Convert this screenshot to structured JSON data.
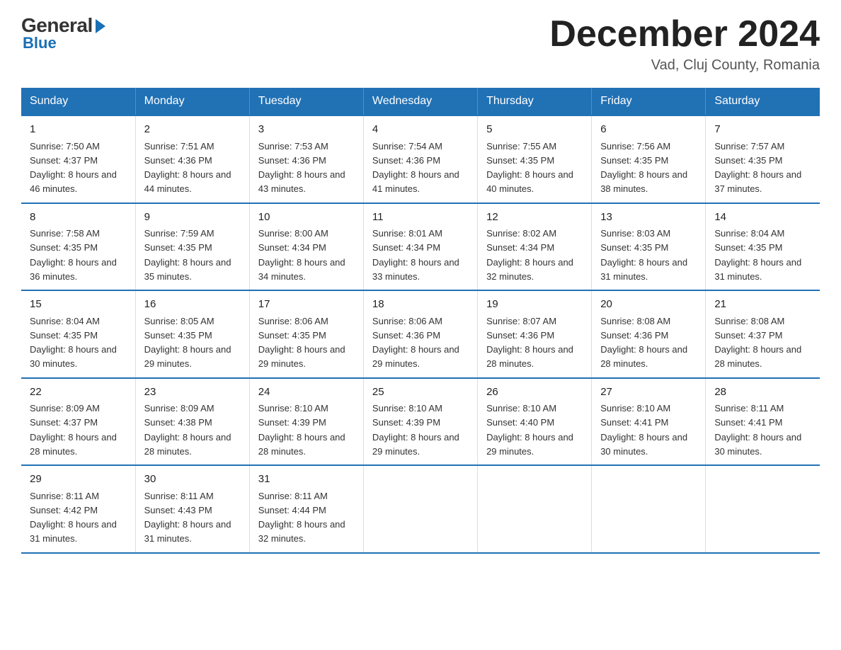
{
  "logo": {
    "general": "General",
    "blue": "Blue"
  },
  "title": "December 2024",
  "subtitle": "Vad, Cluj County, Romania",
  "days_header": [
    "Sunday",
    "Monday",
    "Tuesday",
    "Wednesday",
    "Thursday",
    "Friday",
    "Saturday"
  ],
  "weeks": [
    [
      {
        "day": "1",
        "sunrise": "7:50 AM",
        "sunset": "4:37 PM",
        "daylight": "8 hours and 46 minutes."
      },
      {
        "day": "2",
        "sunrise": "7:51 AM",
        "sunset": "4:36 PM",
        "daylight": "8 hours and 44 minutes."
      },
      {
        "day": "3",
        "sunrise": "7:53 AM",
        "sunset": "4:36 PM",
        "daylight": "8 hours and 43 minutes."
      },
      {
        "day": "4",
        "sunrise": "7:54 AM",
        "sunset": "4:36 PM",
        "daylight": "8 hours and 41 minutes."
      },
      {
        "day": "5",
        "sunrise": "7:55 AM",
        "sunset": "4:35 PM",
        "daylight": "8 hours and 40 minutes."
      },
      {
        "day": "6",
        "sunrise": "7:56 AM",
        "sunset": "4:35 PM",
        "daylight": "8 hours and 38 minutes."
      },
      {
        "day": "7",
        "sunrise": "7:57 AM",
        "sunset": "4:35 PM",
        "daylight": "8 hours and 37 minutes."
      }
    ],
    [
      {
        "day": "8",
        "sunrise": "7:58 AM",
        "sunset": "4:35 PM",
        "daylight": "8 hours and 36 minutes."
      },
      {
        "day": "9",
        "sunrise": "7:59 AM",
        "sunset": "4:35 PM",
        "daylight": "8 hours and 35 minutes."
      },
      {
        "day": "10",
        "sunrise": "8:00 AM",
        "sunset": "4:34 PM",
        "daylight": "8 hours and 34 minutes."
      },
      {
        "day": "11",
        "sunrise": "8:01 AM",
        "sunset": "4:34 PM",
        "daylight": "8 hours and 33 minutes."
      },
      {
        "day": "12",
        "sunrise": "8:02 AM",
        "sunset": "4:34 PM",
        "daylight": "8 hours and 32 minutes."
      },
      {
        "day": "13",
        "sunrise": "8:03 AM",
        "sunset": "4:35 PM",
        "daylight": "8 hours and 31 minutes."
      },
      {
        "day": "14",
        "sunrise": "8:04 AM",
        "sunset": "4:35 PM",
        "daylight": "8 hours and 31 minutes."
      }
    ],
    [
      {
        "day": "15",
        "sunrise": "8:04 AM",
        "sunset": "4:35 PM",
        "daylight": "8 hours and 30 minutes."
      },
      {
        "day": "16",
        "sunrise": "8:05 AM",
        "sunset": "4:35 PM",
        "daylight": "8 hours and 29 minutes."
      },
      {
        "day": "17",
        "sunrise": "8:06 AM",
        "sunset": "4:35 PM",
        "daylight": "8 hours and 29 minutes."
      },
      {
        "day": "18",
        "sunrise": "8:06 AM",
        "sunset": "4:36 PM",
        "daylight": "8 hours and 29 minutes."
      },
      {
        "day": "19",
        "sunrise": "8:07 AM",
        "sunset": "4:36 PM",
        "daylight": "8 hours and 28 minutes."
      },
      {
        "day": "20",
        "sunrise": "8:08 AM",
        "sunset": "4:36 PM",
        "daylight": "8 hours and 28 minutes."
      },
      {
        "day": "21",
        "sunrise": "8:08 AM",
        "sunset": "4:37 PM",
        "daylight": "8 hours and 28 minutes."
      }
    ],
    [
      {
        "day": "22",
        "sunrise": "8:09 AM",
        "sunset": "4:37 PM",
        "daylight": "8 hours and 28 minutes."
      },
      {
        "day": "23",
        "sunrise": "8:09 AM",
        "sunset": "4:38 PM",
        "daylight": "8 hours and 28 minutes."
      },
      {
        "day": "24",
        "sunrise": "8:10 AM",
        "sunset": "4:39 PM",
        "daylight": "8 hours and 28 minutes."
      },
      {
        "day": "25",
        "sunrise": "8:10 AM",
        "sunset": "4:39 PM",
        "daylight": "8 hours and 29 minutes."
      },
      {
        "day": "26",
        "sunrise": "8:10 AM",
        "sunset": "4:40 PM",
        "daylight": "8 hours and 29 minutes."
      },
      {
        "day": "27",
        "sunrise": "8:10 AM",
        "sunset": "4:41 PM",
        "daylight": "8 hours and 30 minutes."
      },
      {
        "day": "28",
        "sunrise": "8:11 AM",
        "sunset": "4:41 PM",
        "daylight": "8 hours and 30 minutes."
      }
    ],
    [
      {
        "day": "29",
        "sunrise": "8:11 AM",
        "sunset": "4:42 PM",
        "daylight": "8 hours and 31 minutes."
      },
      {
        "day": "30",
        "sunrise": "8:11 AM",
        "sunset": "4:43 PM",
        "daylight": "8 hours and 31 minutes."
      },
      {
        "day": "31",
        "sunrise": "8:11 AM",
        "sunset": "4:44 PM",
        "daylight": "8 hours and 32 minutes."
      },
      null,
      null,
      null,
      null
    ]
  ],
  "labels": {
    "sunrise": "Sunrise:",
    "sunset": "Sunset:",
    "daylight": "Daylight:"
  }
}
